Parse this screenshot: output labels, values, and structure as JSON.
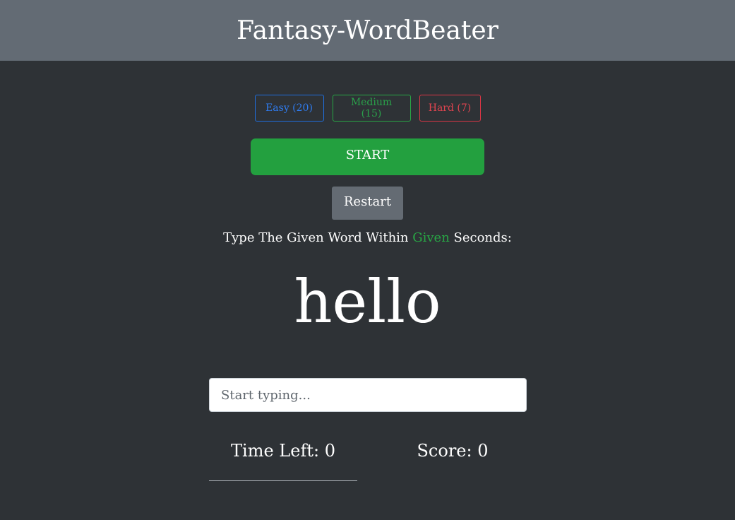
{
  "header": {
    "title": "Fantasy-WordBeater"
  },
  "difficulty": {
    "options": [
      {
        "label": "Easy (20)",
        "color": "#2f7cf0"
      },
      {
        "label": "Medium (15)",
        "color": "#2aa14a"
      },
      {
        "label": "Hard (7)",
        "color": "#e0444f"
      }
    ]
  },
  "controls": {
    "start_label": "START",
    "restart_label": "Restart"
  },
  "instruction": {
    "prefix": "Type The Given Word Within ",
    "seconds": "Given",
    "suffix": " Seconds:"
  },
  "current_word": "hello",
  "input": {
    "placeholder": "Start typing...",
    "value": ""
  },
  "stats": {
    "time_left_label": "Time Left: ",
    "time_left": "0",
    "score_label": "Score: ",
    "score": "0"
  },
  "colors": {
    "header_bg": "#636b74",
    "page_bg": "#2e3236",
    "start_bg": "#23a03f",
    "restart_bg": "#646b73",
    "accent_green": "#28a745"
  }
}
